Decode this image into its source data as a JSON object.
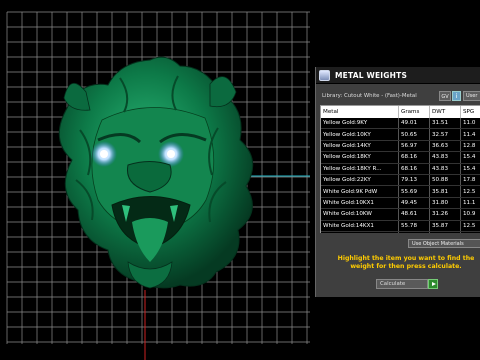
{
  "panel": {
    "title": "METAL WEIGHTS",
    "library_label": "Library: Cutout White - (Fast)-Metal",
    "gv_label": "GV",
    "info_label": "i",
    "user_label": "User",
    "columns": [
      "Metal",
      "Grams",
      "DWT",
      "SPG"
    ],
    "rows": [
      {
        "metal": "Yellow Gold:9KY",
        "grams": "49.01",
        "dwt": "31.51",
        "spg": "11.0"
      },
      {
        "metal": "Yellow Gold:10KY",
        "grams": "50.65",
        "dwt": "32.57",
        "spg": "11.4"
      },
      {
        "metal": "Yellow Gold:14KY",
        "grams": "56.97",
        "dwt": "36.63",
        "spg": "12.8"
      },
      {
        "metal": "Yellow Gold:18KY",
        "grams": "68.16",
        "dwt": "43.83",
        "spg": "15.4"
      },
      {
        "metal": "Yellow Gold:18KY R...",
        "grams": "68.16",
        "dwt": "43.83",
        "spg": "15.4"
      },
      {
        "metal": "Yellow Gold:22KY",
        "grams": "79.13",
        "dwt": "50.88",
        "spg": "17.8"
      },
      {
        "metal": "White Gold:9K PdW",
        "grams": "55.69",
        "dwt": "35.81",
        "spg": "12.5"
      },
      {
        "metal": "White Gold:10KX1",
        "grams": "49.45",
        "dwt": "31.80",
        "spg": "11.1"
      },
      {
        "metal": "White Gold:10KW",
        "grams": "48.61",
        "dwt": "31.26",
        "spg": "10.9"
      },
      {
        "metal": "White Gold:14KX1",
        "grams": "55.78",
        "dwt": "35.87",
        "spg": "12.5"
      },
      {
        "metal": "White Gold:14K PdW",
        "grams": "63.56",
        "dwt": "40.87",
        "spg": "14.3"
      }
    ],
    "use_object_materials": "Use Object Materials",
    "hint": "Highlight the item you want to find the weight for then press calculate.",
    "calculate_label": "Calculate"
  },
  "colors": {
    "model_green": "#0f7a4a",
    "grid_line": "#9a9a9a",
    "axis_red": "#cc2222",
    "axis_cyan": "#22b8c8",
    "hint_yellow": "#ffcc00"
  }
}
